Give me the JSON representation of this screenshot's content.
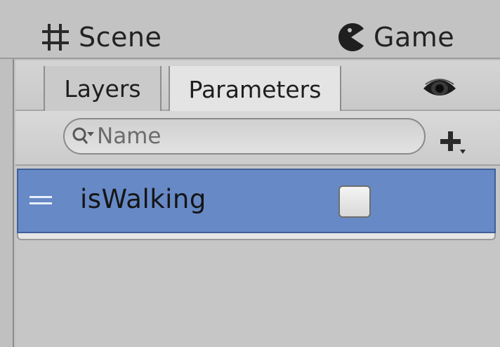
{
  "window_tabs": [
    {
      "label": "Scene",
      "icon": "grid-icon"
    },
    {
      "label": "Game",
      "icon": "pacman-icon"
    }
  ],
  "panel": {
    "tabs": [
      {
        "label": "Layers",
        "active": false
      },
      {
        "label": "Parameters",
        "active": true
      }
    ],
    "eye_icon": "eye-icon"
  },
  "search": {
    "placeholder": "Name",
    "value": ""
  },
  "add_button_icon": "plus-icon",
  "parameters": [
    {
      "name": "isWalking",
      "type": "bool",
      "checked": false
    }
  ],
  "colors": {
    "selection": "#6789c6",
    "background": "#c6c6c6"
  }
}
